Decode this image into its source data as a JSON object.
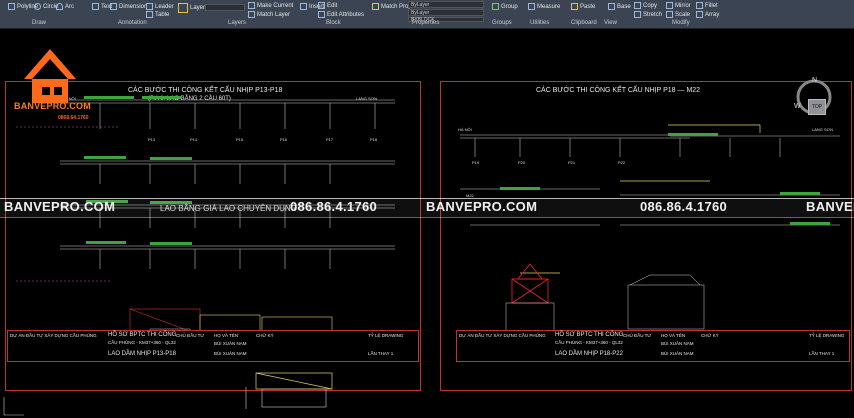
{
  "ribbon": {
    "draw": [
      "Polyline",
      "Circle",
      "Arc"
    ],
    "draw_panel": "Draw",
    "annotation": [
      "Text",
      "Dimension",
      "Leader",
      "Table"
    ],
    "annotation_panel": "Annotation",
    "layers": [
      "Layer Properties"
    ],
    "layer_tools": [
      "Make Current",
      "Match Layer"
    ],
    "layers_panel": "Layers",
    "block": [
      "Insert",
      "Edit",
      "Edit Attributes"
    ],
    "block_panel": "Block",
    "properties": [
      "Match Properties"
    ],
    "prop_drops": [
      "ByLayer",
      "ByLayer",
      "BYBLOCK"
    ],
    "properties_panel": "Properties",
    "groups": [
      "Group"
    ],
    "groups_panel": "Groups",
    "utilities": [
      "Measure"
    ],
    "utilities_panel": "Utilities",
    "clipboard": [
      "Paste"
    ],
    "clipboard_panel": "Clipboard",
    "view": [
      "Base"
    ],
    "view_panel": "View",
    "modify": [
      "Copy",
      "Mirror",
      "Fillet",
      "Stretch",
      "Scale",
      "Array"
    ],
    "modify_panel": "Modify"
  },
  "logo": {
    "name": "BANVEPRO.COM",
    "phone": "0868.64.1760"
  },
  "watermark": {
    "left": "BANVEPRO.COM",
    "middle_small": "LAO BẰNG GIÁ LAO CHUYÊN DỤNG",
    "phone_left": "086.86.4.1760",
    "center": "BANVEPRO.COM",
    "phone_right": "086.86.4.1760",
    "right": "BANVEPRO"
  },
  "sheet1": {
    "title": "CÁC BƯỚC THI CÔNG KẾT CẤU NHỊP P13-P18",
    "subtitle": "(P.A 1: LAO BẰNG 2 CẦU 60T)",
    "labels": [
      "HÀ NỘI",
      "LẠNG SƠN",
      "P13",
      "P14",
      "P15",
      "P16",
      "P17",
      "P18"
    ],
    "tb": {
      "project": "DỰ ÁN ĐẦU TƯ XÂY DỰNG CẦU PHÙNG",
      "doc": "HỒ SƠ BPTC THI CÔNG",
      "doc2": "CẦU PHÙNG - KM37+360 - QL32",
      "name": "LAO DẦM NHỊP P13-P18",
      "roles": [
        "CHỦ ĐẦU TƯ",
        "HỌ VÀ TÊN",
        "CHỮ KÝ"
      ],
      "people": [
        "BÙI XUÂN NAM",
        "BÙI XUÂN NAM"
      ],
      "drawing": "TỶ LỆ DRAWING",
      "page": "LẦN THAY 1"
    }
  },
  "sheet2": {
    "title": "CÁC BƯỚC THI CÔNG KẾT CẤU NHỊP P18 — M22",
    "labels": [
      "HÀ NỘI",
      "LẠNG SƠN",
      "P19",
      "P20",
      "P21",
      "P22",
      "M22"
    ],
    "tb": {
      "project": "DỰ ÁN ĐẦU TƯ XÂY DỰNG CẦU PHÙNG",
      "doc": "HỒ SƠ BPTC THI CÔNG",
      "doc2": "CẦU PHÙNG - KM37+360 - QL32",
      "name": "LAO DẦM NHỊP P18-P22",
      "roles": [
        "CHỦ ĐẦU TƯ",
        "HỌ VÀ TÊN",
        "CHỮ KÝ"
      ],
      "people": [
        "BÙI XUÂN NAM",
        "BÙI XUÂN NAM"
      ],
      "drawing": "TỶ LỆ DRAWING",
      "page": "LẦN THAY 1"
    }
  },
  "viewcube": {
    "n": "N",
    "w": "W",
    "top": "TOP"
  }
}
